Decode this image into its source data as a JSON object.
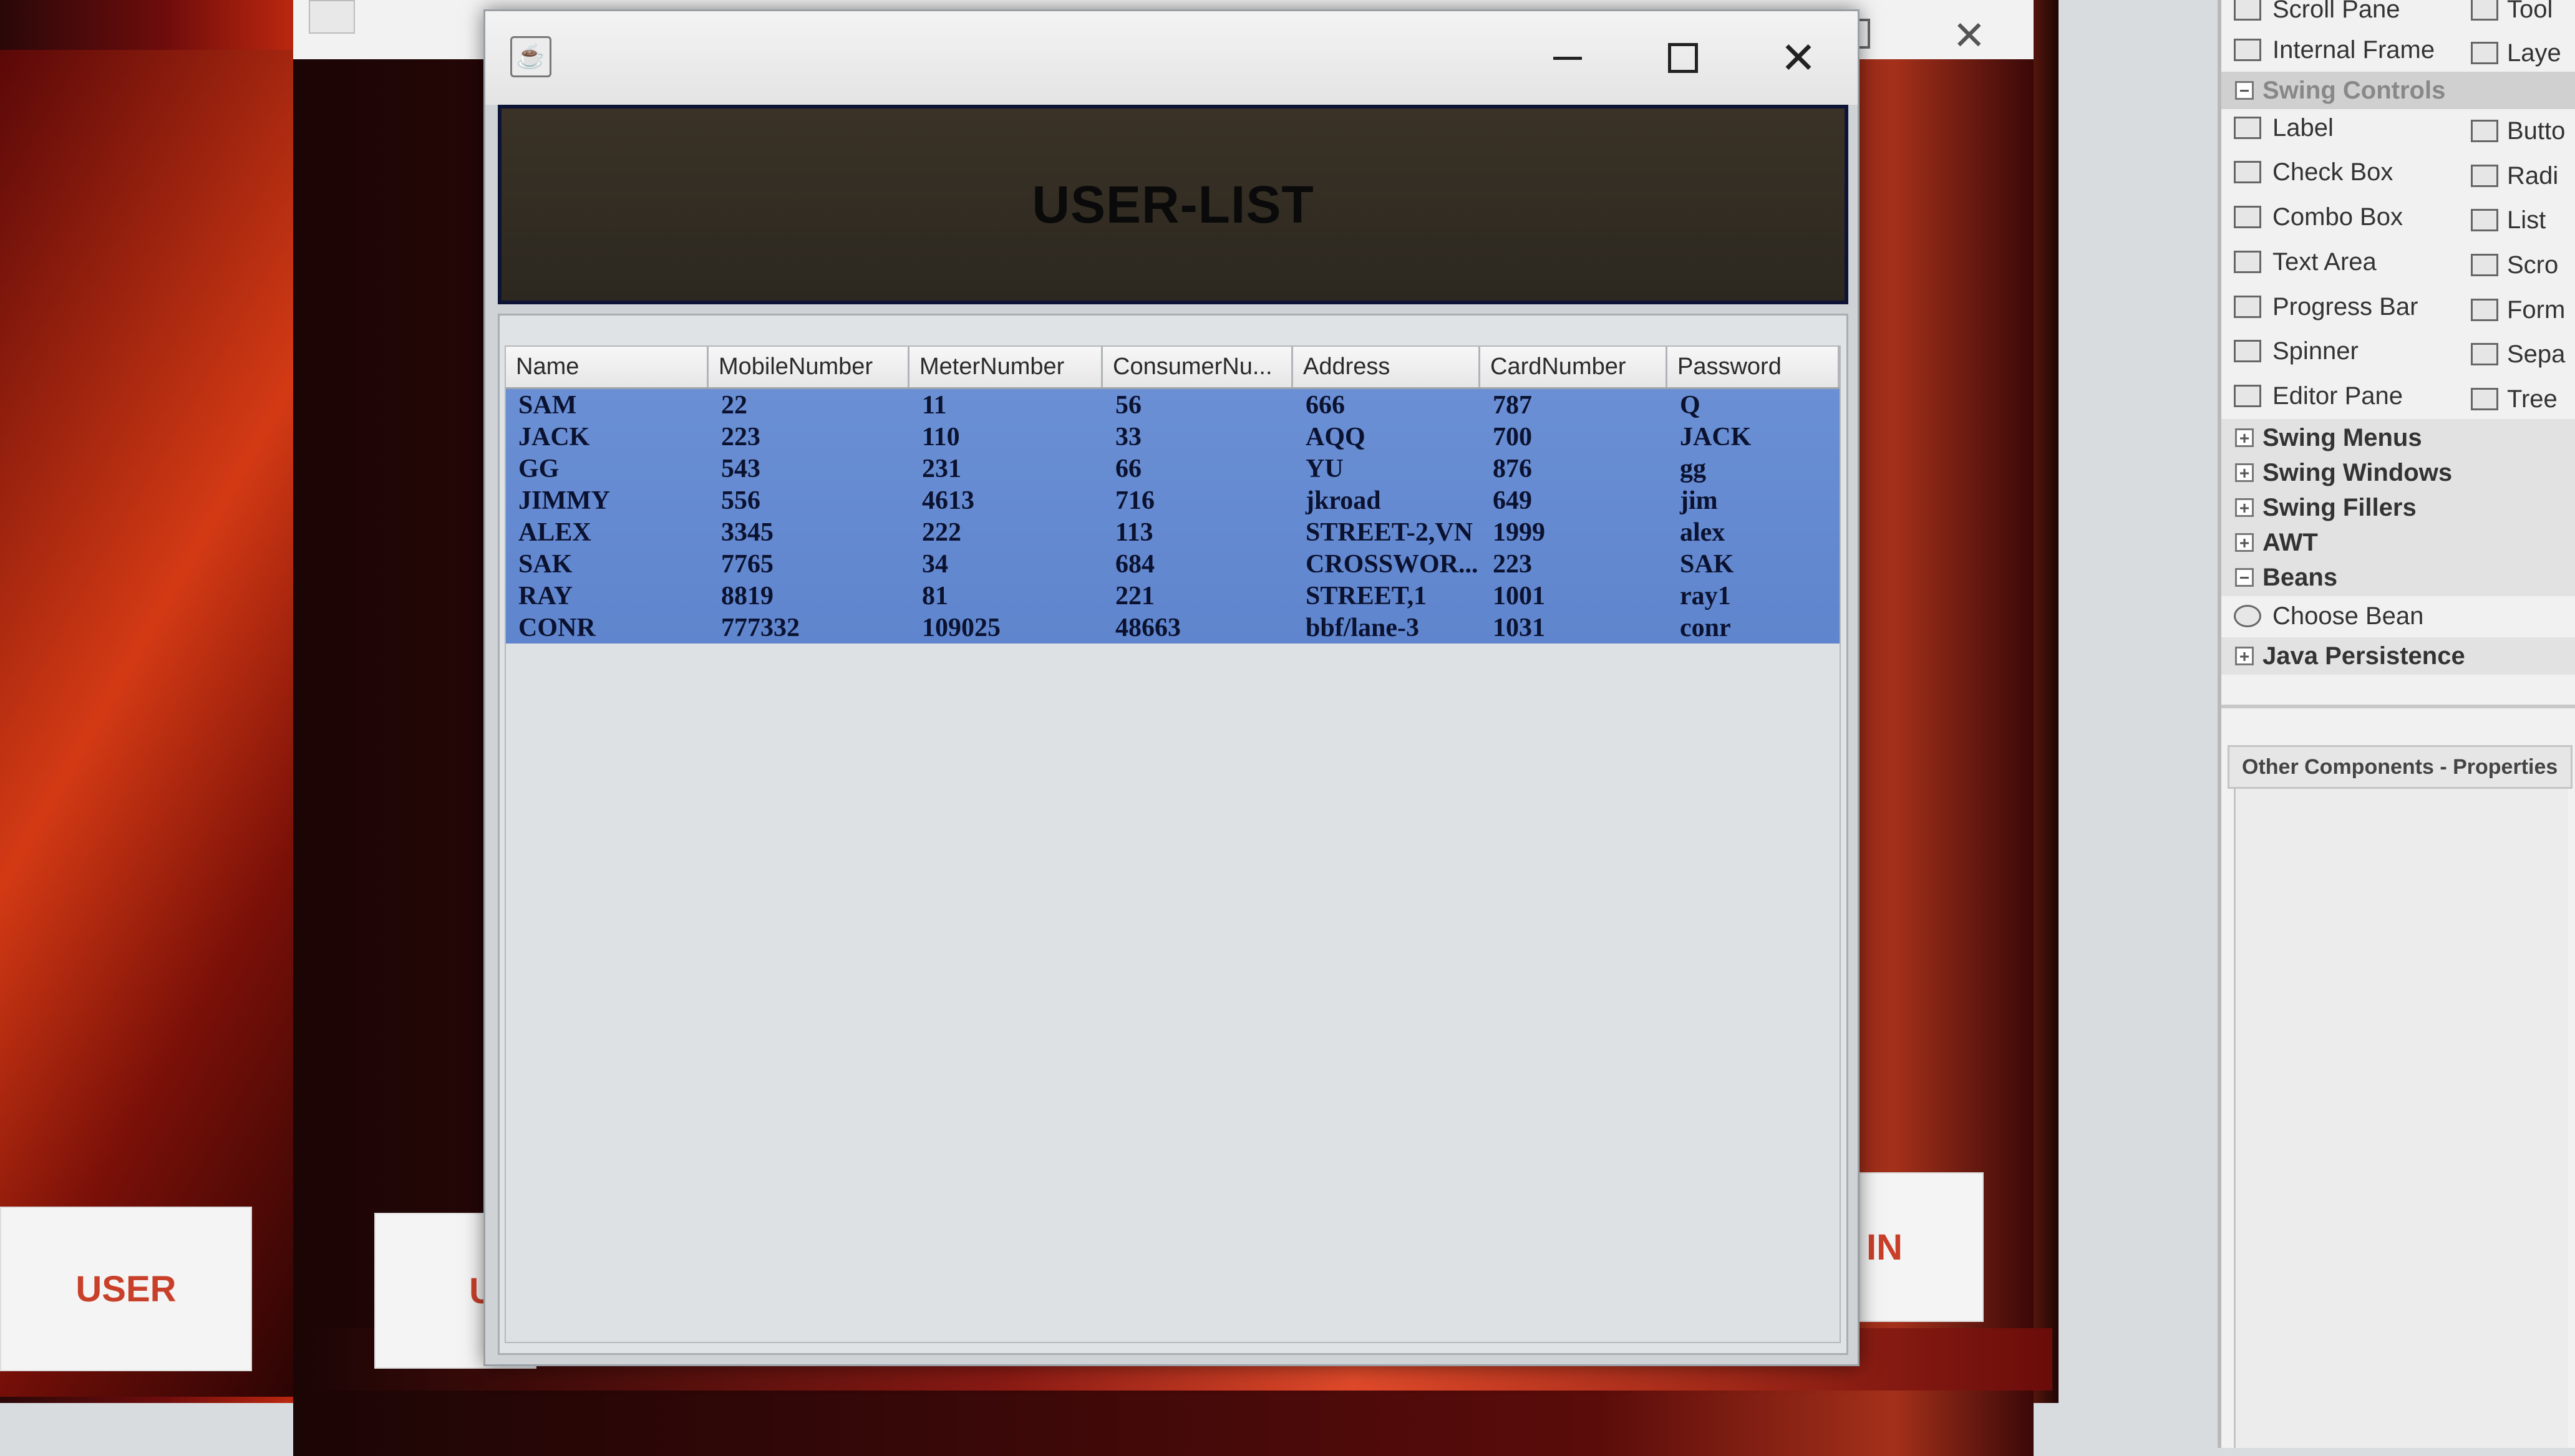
{
  "background": {
    "user_button_label": "USER",
    "u_button_label": "U",
    "in_button_label": "IN"
  },
  "palette": {
    "rows": [
      {
        "col1": "Scroll Pane",
        "col2": "Tool"
      },
      {
        "col1": "Internal Frame",
        "col2": "Laye"
      }
    ],
    "categories": {
      "swing_controls": "Swing Controls",
      "swing_menus": "Swing Menus",
      "swing_windows": "Swing Windows",
      "swing_fillers": "Swing Fillers",
      "awt": "AWT",
      "beans": "Beans",
      "java_persistence": "Java Persistence"
    },
    "controls": [
      {
        "col1": "Label",
        "col2": "Butto"
      },
      {
        "col1": "Check Box",
        "col2": "Radi"
      },
      {
        "col1": "Combo Box",
        "col2": "List"
      },
      {
        "col1": "Text Area",
        "col2": "Scro"
      },
      {
        "col1": "Progress Bar",
        "col2": "Form"
      },
      {
        "col1": "Spinner",
        "col2": "Sepa"
      },
      {
        "col1": "Editor Pane",
        "col2": "Tree"
      }
    ],
    "choose_bean": "Choose Bean",
    "properties_header": "Other Components - Properties"
  },
  "dialog": {
    "title_text": "USER-LIST",
    "columns": [
      "Name",
      "MobileNumber",
      "MeterNumber",
      "ConsumerNu...",
      "Address",
      "CardNumber",
      "Password"
    ],
    "rows": [
      [
        "SAM",
        "22",
        "11",
        "56",
        "666",
        "787",
        "Q"
      ],
      [
        "JACK",
        "223",
        "110",
        "33",
        "AQQ",
        "700",
        "JACK"
      ],
      [
        "GG",
        "543",
        "231",
        "66",
        "YU",
        "876",
        "gg"
      ],
      [
        "JIMMY",
        "556",
        "4613",
        "716",
        "jkroad",
        "649",
        "jim"
      ],
      [
        "ALEX",
        "3345",
        "222",
        "113",
        "STREET-2,VN",
        "1999",
        "alex"
      ],
      [
        "SAK",
        "7765",
        "34",
        "684",
        "CROSSWOR...",
        "223",
        "SAK"
      ],
      [
        "RAY",
        "8819",
        "81",
        "221",
        "STREET,1",
        "1001",
        "ray1"
      ],
      [
        "CONR",
        "777332",
        "109025",
        "48663",
        "bbf/lane-3",
        "1031",
        "conr"
      ]
    ]
  }
}
